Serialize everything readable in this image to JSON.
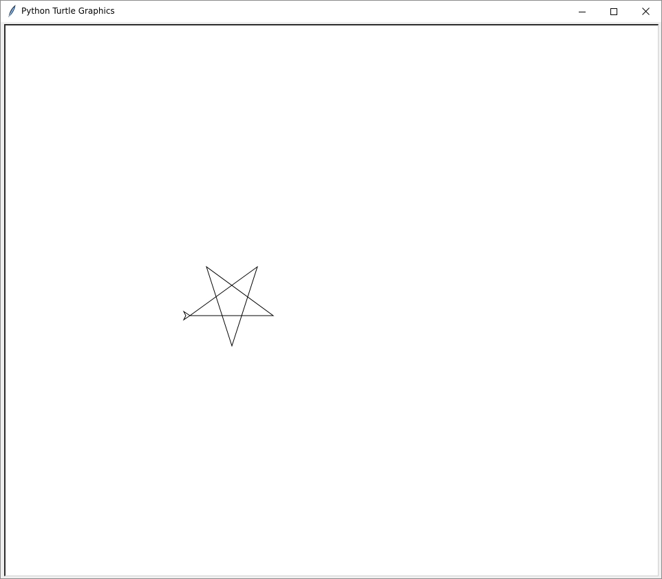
{
  "window": {
    "title": "Python Turtle Graphics",
    "icon": "feather-icon"
  },
  "controls": {
    "minimize": "minimize-icon",
    "maximize": "maximize-icon",
    "close": "close-icon"
  },
  "drawing": {
    "shape": "star-icon",
    "stroke_color": "#000000",
    "turtle": "turtle-cursor-icon"
  }
}
